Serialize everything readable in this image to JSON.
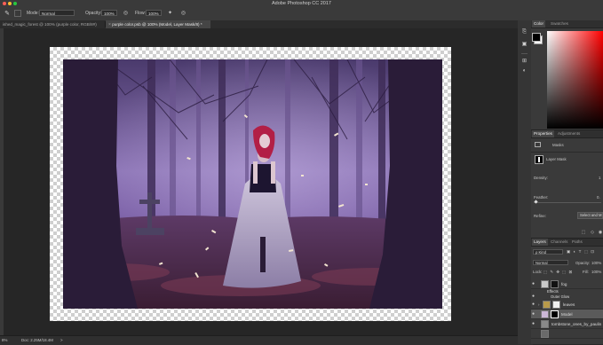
{
  "app": {
    "title": "Adobe Photoshop CC 2017"
  },
  "options_bar": {
    "mode_label": "Mode:",
    "mode_value": "Normal",
    "opacity_label": "Opacity:",
    "opacity_value": "100%",
    "flow_label": "Flow:",
    "flow_value": "100%"
  },
  "tabs": [
    {
      "label": "ished_magic_forest @ 100% (purple color, RGB/8#)",
      "active": false,
      "close": "×"
    },
    {
      "label": "purple color.psb @ 100% (Model, Layer Mask/8) *",
      "active": true,
      "close": "×"
    }
  ],
  "status": {
    "zoom": "8%",
    "doc": "Doc: 2.25M/18.4M",
    "arrow": ">"
  },
  "color_panel": {
    "tabs": [
      "Color",
      "Swatches"
    ],
    "foreground": "#000000",
    "background": "#ffffff",
    "hue_color": "#ff0000"
  },
  "properties_panel": {
    "tabs": [
      "Properties",
      "Adjustments"
    ],
    "title": "Masks",
    "layer_mask_label": "Layer Mask",
    "density_label": "Density:",
    "density_value": "1",
    "feather_label": "Feather:",
    "feather_value": "0.",
    "refine_label": "Refine:",
    "select_mask_label": "Select and M"
  },
  "layers_panel": {
    "tabs": [
      "Layers",
      "Channels",
      "Paths"
    ],
    "kind_label": "ρ Kind",
    "blend_mode": "Normal",
    "opacity_label": "Opacity:",
    "opacity_value": "100%",
    "lock_label": "Lock:",
    "fill_label": "Fill:",
    "fill_value": "100%",
    "layers": [
      {
        "name": "fog",
        "selected": false,
        "kind": "mask"
      },
      {
        "name": "Effects",
        "selected": false,
        "kind": "effects"
      },
      {
        "name": "Outer Glow",
        "selected": false,
        "kind": "effect"
      },
      {
        "name": "leaves",
        "selected": false,
        "kind": "group"
      },
      {
        "name": "Model",
        "selected": true,
        "kind": "mask"
      },
      {
        "name": "tombstone_ones_by_paulin",
        "selected": false,
        "kind": "image"
      }
    ]
  }
}
